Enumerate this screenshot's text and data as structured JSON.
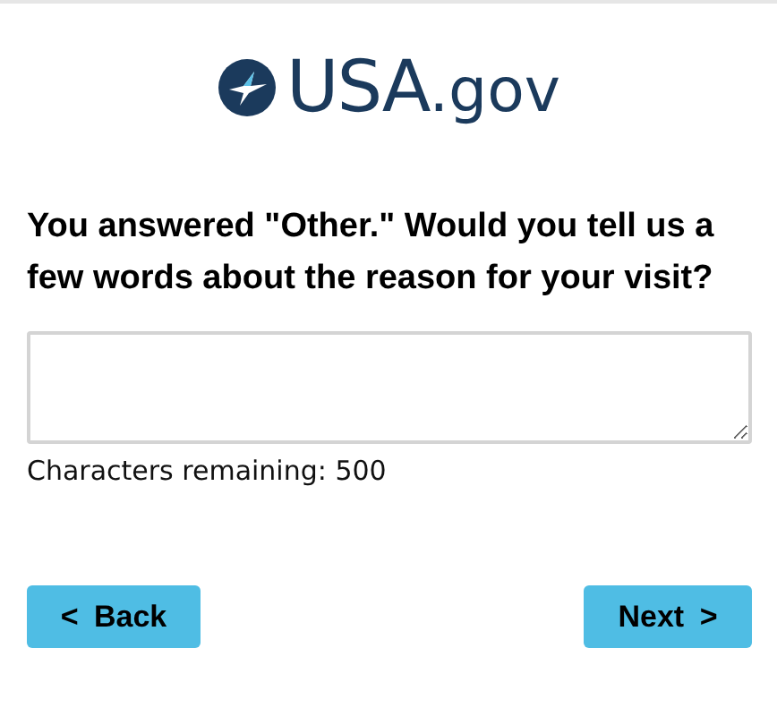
{
  "logo": {
    "name": "USA",
    "suffix": ".gov"
  },
  "question": "You answered \"Other.\" Would you tell us a few words about the reason for your visit?",
  "counter": "Characters remaining: 500",
  "buttons": [
    {
      "kind": "back",
      "label": "< Back"
    },
    {
      "kind": "next",
      "label": "Next >"
    }
  ]
}
